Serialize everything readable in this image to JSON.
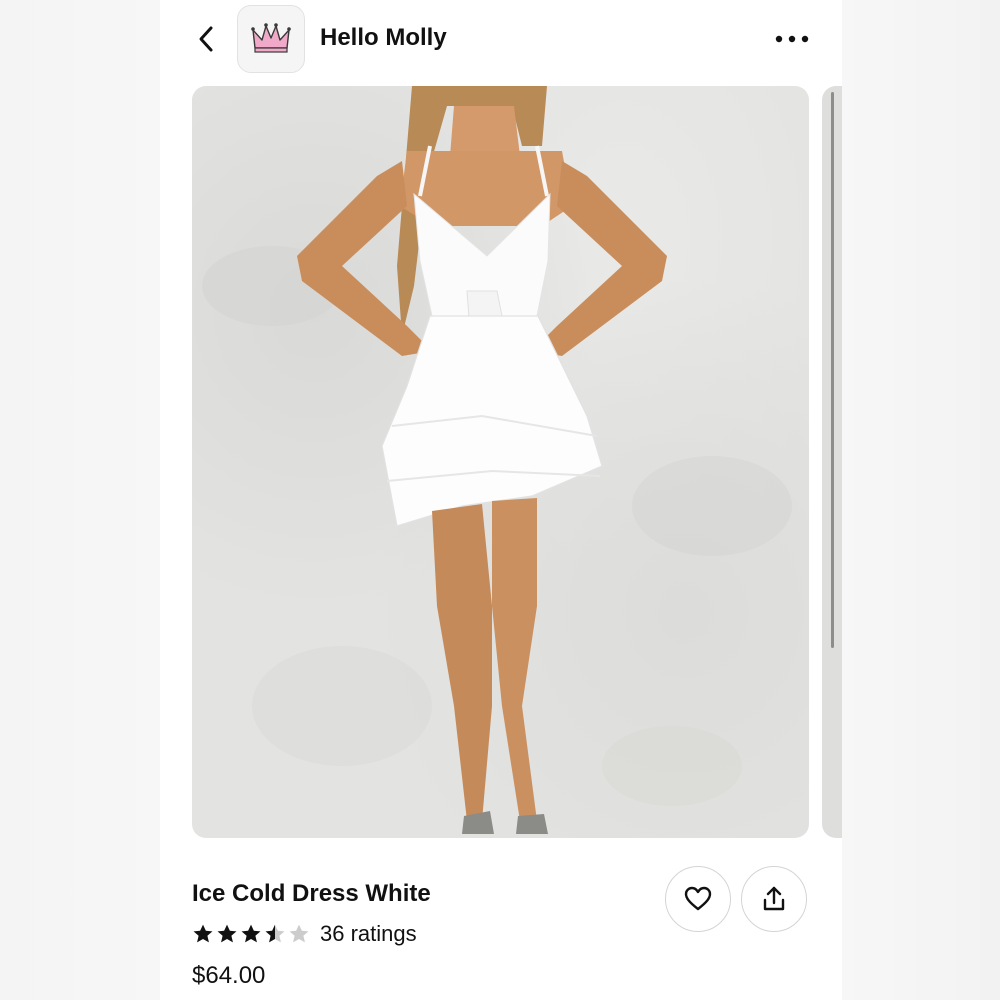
{
  "header": {
    "shop_name": "Hello Molly",
    "back_icon": "chevron-left-icon",
    "logo_icon": "crown-icon",
    "more_icon": "more-horizontal-icon"
  },
  "product": {
    "image_alt": "model wearing white ruffled mini dress",
    "title": "Ice Cold Dress White",
    "rating": 3.5,
    "max_rating": 5,
    "ratings_label": "36 ratings",
    "price": "$64.00"
  },
  "actions": {
    "favorite_icon": "heart-icon",
    "share_icon": "share-icon"
  },
  "colors": {
    "text": "#111111",
    "star_filled": "#111111",
    "star_empty": "#cccccc",
    "logo_crown": "#f0a9c8"
  }
}
